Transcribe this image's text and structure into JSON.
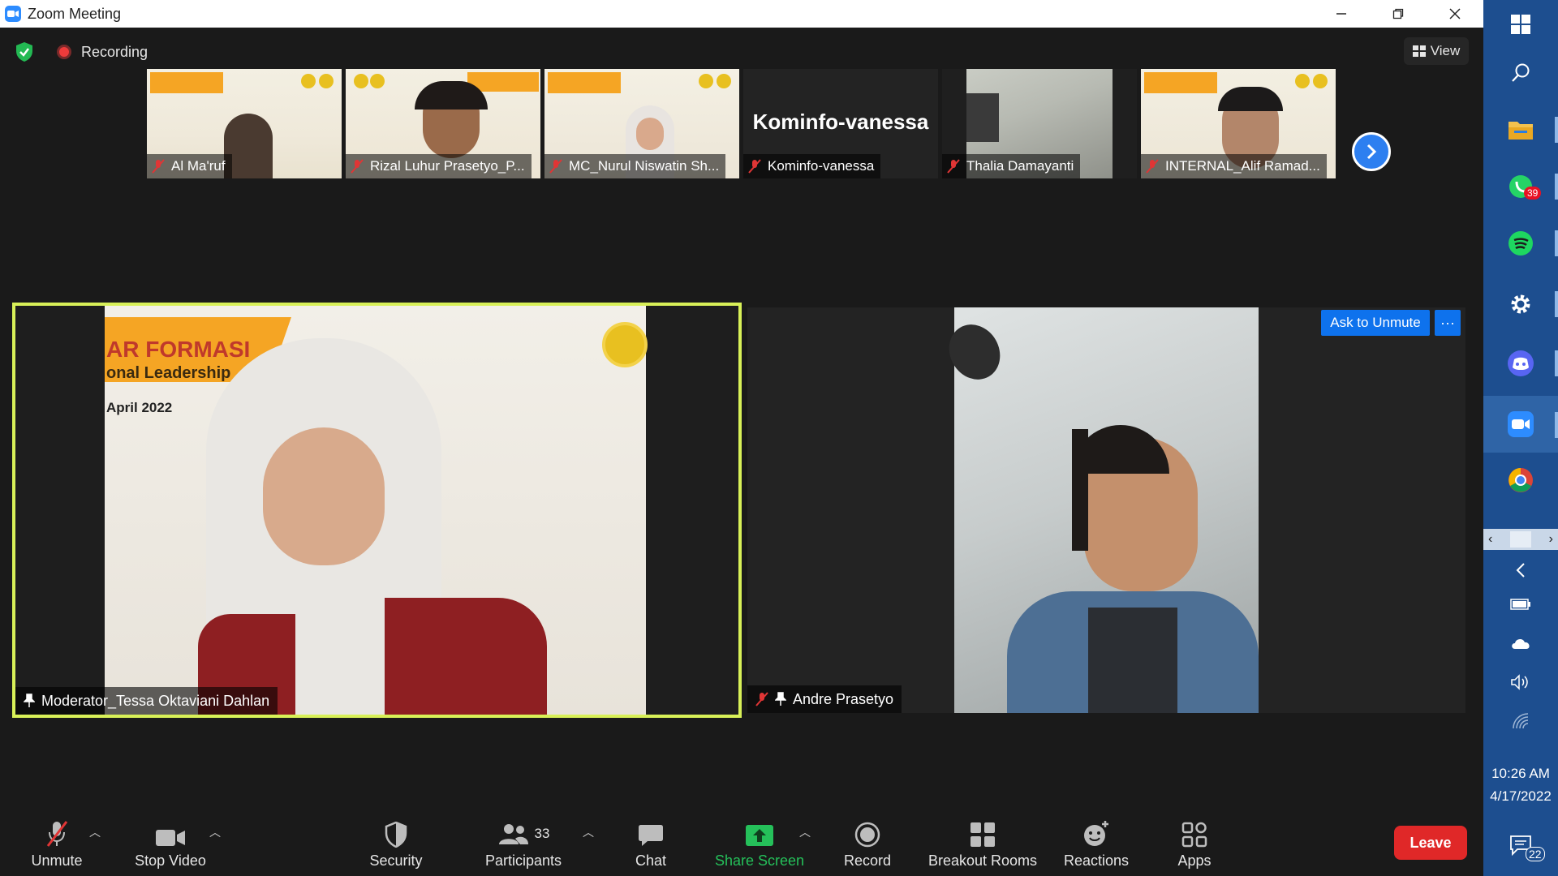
{
  "window": {
    "title": "Zoom Meeting",
    "controls": [
      "minimize",
      "restore",
      "close"
    ]
  },
  "meeting": {
    "recording_label": "Recording",
    "view_label": "View",
    "thumbnails": [
      {
        "name": "Al Ma'ruf"
      },
      {
        "name": "Rizal Luhur Prasetyo_P..."
      },
      {
        "name": "MC_Nurul Niswatin Sh..."
      },
      {
        "name": "Kominfo-vanessa",
        "display_name": "Kominfo-vanessa"
      },
      {
        "name": "Thalia Damayanti"
      },
      {
        "name": "INTERNAL_Alif Ramad..."
      }
    ],
    "slide_text": {
      "line1": "AR FORMASI",
      "line2": "onal Leadership",
      "line3": "April 2022"
    },
    "main_left_name": "Moderator_Tessa Oktaviani Dahlan",
    "main_right_name": "Andre Prasetyo",
    "ask_to_unmute": "Ask to Unmute",
    "more": "···"
  },
  "toolbar": {
    "unmute": "Unmute",
    "stop_video": "Stop Video",
    "security": "Security",
    "participants": "Participants",
    "participants_count": "33",
    "chat": "Chat",
    "share_screen": "Share Screen",
    "record": "Record",
    "breakout_rooms": "Breakout Rooms",
    "reactions": "Reactions",
    "apps": "Apps",
    "leave": "Leave"
  },
  "taskbar": {
    "whatsapp_badge": "39",
    "time": "10:26 AM",
    "date": "4/17/2022",
    "notifications_count": "22"
  },
  "colors": {
    "zoom_blue": "#0e72ed",
    "active_speaker": "#d8f058",
    "leave_red": "#e02828",
    "share_green": "#25c05a",
    "taskbar_blue": "#1d4e8f"
  }
}
